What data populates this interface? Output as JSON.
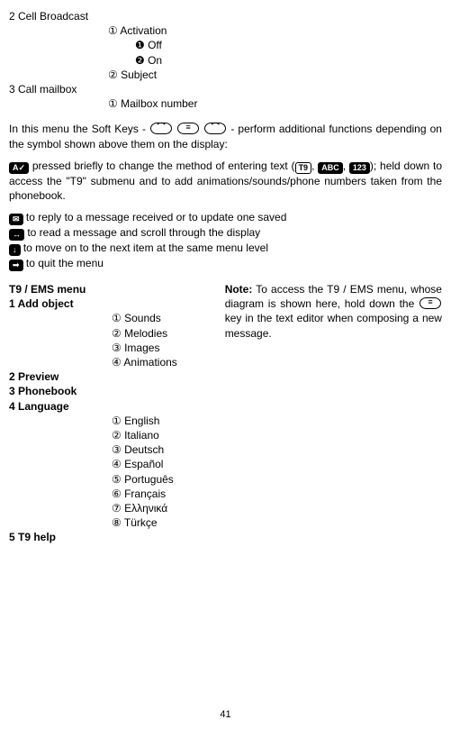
{
  "topList": {
    "item2": {
      "label": "2 Cell Broadcast",
      "s1": "① Activation",
      "s1a": "❶ Off",
      "s1b": "❷ On",
      "s2": "② Subject"
    },
    "item3": {
      "label": "3 Call mailbox",
      "s1": "① Mailbox number"
    }
  },
  "para1_a": "In this menu the Soft Keys - ",
  "para1_b": " - perform additional functions depending on the symbol shown above them on the display:",
  "line_change_a": " pressed briefly to change the method of entering text (",
  "line_change_b": "); held down to access the \"T9\" submenu and to add animations/sounds/phone numbers taken from the phonebook.",
  "icon_sep1": ", ",
  "icon_sep2": ", ",
  "line_reply": " to reply to a message received or to update one saved",
  "line_read": " to read a message and scroll through the display",
  "line_move": " to move on to the next item at the same menu level",
  "line_quit": " to quit the menu",
  "t9": {
    "title": "T9 / EMS menu",
    "i1": "1  Add object",
    "i1s1": "①  Sounds",
    "i1s2": "② Melodies",
    "i1s3": "③ Images",
    "i1s4": "④ Animations",
    "i2": "2  Preview",
    "i3": "3  Phonebook",
    "i4": "4  Language",
    "i4s1": "① English",
    "i4s2": "② Italiano",
    "i4s3": "③ Deutsch",
    "i4s4": "④ Español",
    "i4s5": "⑤ Português",
    "i4s6": "⑥ Français",
    "i4s7": "⑦ Ελληνικά",
    "i4s8": "⑧ Türkçe",
    "i5": "5  T9 help"
  },
  "note_a": "Note:",
  "note_b": " To access the T9 / EMS menu, whose diagram is shown here, hold down the ",
  "note_c": " key in the text editor when composing a new message.",
  "inputModes": {
    "t9": "T9",
    "abc": "ABC",
    "num": "123"
  },
  "iconGlyphs": {
    "sel": "A✓",
    "env": "✉",
    "scroll": "↔",
    "down": "↓",
    "exit": "➟"
  },
  "page": "41"
}
